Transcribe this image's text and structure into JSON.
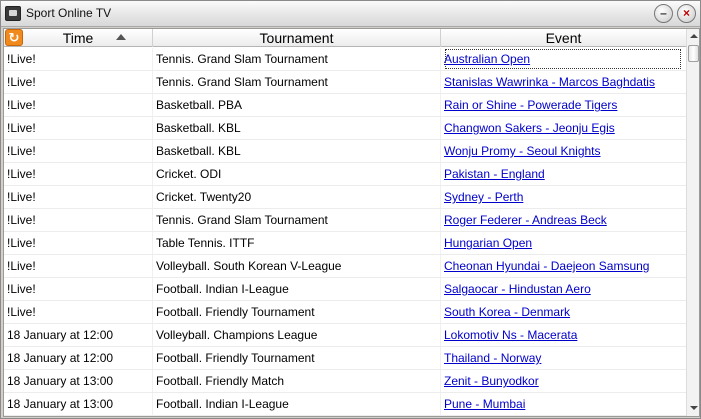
{
  "window": {
    "title": "Sport Online TV",
    "minimize_label": "–",
    "close_label": "×"
  },
  "columns": {
    "time": "Time",
    "tournament": "Tournament",
    "event": "Event"
  },
  "refresh_icon": "↻",
  "rows": [
    {
      "time": "!Live!",
      "tournament": "Tennis. Grand Slam Tournament",
      "event": "Australian Open"
    },
    {
      "time": "!Live!",
      "tournament": "Tennis. Grand Slam Tournament",
      "event": "Stanislas Wawrinka -  Marcos Baghdatis"
    },
    {
      "time": "!Live!",
      "tournament": "Basketball. PBA",
      "event": "Rain or Shine -  Powerade Tigers"
    },
    {
      "time": "!Live!",
      "tournament": "Basketball. KBL",
      "event": "Changwon Sakers -  Jeonju Egis"
    },
    {
      "time": "!Live!",
      "tournament": "Basketball. KBL",
      "event": "Wonju Promy -  Seoul Knights"
    },
    {
      "time": "!Live!",
      "tournament": "Cricket. ODI",
      "event": "Pakistan -  England"
    },
    {
      "time": "!Live!",
      "tournament": "Cricket. Twenty20",
      "event": "Sydney -  Perth"
    },
    {
      "time": "!Live!",
      "tournament": "Tennis. Grand Slam Tournament",
      "event": "Roger Federer -  Andreas Beck"
    },
    {
      "time": "!Live!",
      "tournament": "Table Tennis. ITTF",
      "event": "Hungarian Open"
    },
    {
      "time": "!Live!",
      "tournament": "Volleyball. South Korean V-League",
      "event": "Cheonan Hyundai -  Daejeon Samsung"
    },
    {
      "time": "!Live!",
      "tournament": "Football. Indian I-League",
      "event": "Salgaocar -  Hindustan Aero"
    },
    {
      "time": "!Live!",
      "tournament": "Football. Friendly Tournament",
      "event": "South Korea -  Denmark"
    },
    {
      "time": "18 January at 12:00",
      "tournament": "Volleyball. Champions League",
      "event": "Lokomotiv Ns -  Macerata"
    },
    {
      "time": "18 January at 12:00",
      "tournament": "Football. Friendly Tournament",
      "event": "Thailand -  Norway"
    },
    {
      "time": "18 January at 13:00",
      "tournament": "Football. Friendly Match",
      "event": "Zenit -  Bunyodkor"
    },
    {
      "time": "18 January at 13:00",
      "tournament": "Football. Indian I-League",
      "event": "Pune -  Mumbai"
    }
  ]
}
